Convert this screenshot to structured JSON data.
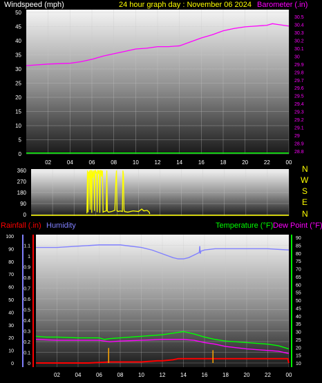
{
  "header": {
    "left_label": "Windspeed (mph)",
    "title": "24 hour graph day : November 06 2024",
    "right_label": "Barometer (.in)"
  },
  "colors": {
    "background": "#000000",
    "white_text": "#ffffff",
    "title_yellow": "#ffff00",
    "barometer": "#ff00ff",
    "windspeed": "#00ff00",
    "wind_dir": "#ffff00",
    "rain_axis": "#ff0000",
    "humidity": "#8080ff",
    "temperature": "#00ff00",
    "dew_point": "#ff00ff",
    "rain_total": "#ff0000",
    "rain_rate": "#ffa500"
  },
  "compass": [
    "N",
    "W",
    "S",
    "E",
    "N"
  ],
  "bottom_labels": {
    "rainfall": "Rainfall (.in)",
    "humidity": "Humidity",
    "temperature": "Temperature (°F)",
    "dew_point": "Dew Point (°F)"
  },
  "chart_data": [
    {
      "type": "line",
      "id": "wind_baro",
      "x_ticks": [
        "02",
        "04",
        "06",
        "08",
        "10",
        "12",
        "14",
        "16",
        "18",
        "20",
        "22",
        "00"
      ],
      "xlim": [
        0,
        24
      ],
      "left_axis": {
        "label": "Windspeed (mph)",
        "ticks": [
          0,
          5,
          10,
          15,
          20,
          25,
          30,
          35,
          40,
          45,
          50
        ],
        "ylim": [
          0,
          50
        ]
      },
      "right_axis": {
        "label": "Barometer (.in)",
        "ticks": [
          "28.8",
          "28.9",
          "29",
          "29.1",
          "29.2",
          "29.3",
          "29.4",
          "29.5",
          "29.6",
          "29.7",
          "29.8",
          "29.9",
          "30",
          "30.1",
          "30.2",
          "30.3",
          "30.4",
          "30.5"
        ],
        "ylim": [
          28.8,
          30.5
        ]
      },
      "series": [
        {
          "name": "Barometer (.in)",
          "axis": "right",
          "x": [
            0,
            2,
            4,
            5,
            6,
            7,
            8,
            9,
            10,
            11,
            12,
            13,
            14,
            15,
            16,
            17,
            18,
            19,
            20,
            21,
            22,
            22.5,
            23,
            24
          ],
          "y": [
            29.88,
            29.9,
            29.91,
            29.93,
            29.96,
            30.0,
            30.03,
            30.06,
            30.09,
            30.1,
            30.12,
            30.12,
            30.13,
            30.18,
            30.23,
            30.27,
            30.32,
            30.35,
            30.37,
            30.38,
            30.39,
            30.41,
            30.4,
            30.38
          ]
        },
        {
          "name": "Windspeed (mph)",
          "axis": "left",
          "x": [
            0,
            24
          ],
          "y": [
            0.3,
            0.3
          ]
        }
      ]
    },
    {
      "type": "line",
      "id": "wind_direction",
      "xlim": [
        0,
        24
      ],
      "y_ticks": [
        0,
        90,
        180,
        270,
        360
      ],
      "ylim": [
        0,
        360
      ],
      "series": [
        {
          "name": "Wind direction",
          "x": [
            0,
            5.2,
            5.25,
            5.3,
            5.35,
            5.4,
            5.45,
            5.5,
            5.55,
            5.6,
            5.65,
            5.7,
            5.75,
            5.8,
            5.85,
            5.9,
            5.95,
            6.0,
            6.05,
            6.1,
            6.15,
            6.2,
            6.25,
            6.3,
            6.35,
            6.4,
            6.45,
            6.5,
            6.55,
            6.6,
            6.65,
            6.7,
            6.8,
            7.0,
            7.05,
            7.1,
            7.2,
            7.5,
            7.8,
            7.9,
            7.95,
            8.0,
            8.05,
            8.1,
            8.3,
            8.5,
            8.55,
            8.6,
            8.65,
            8.7,
            9.0,
            9.5,
            10.0,
            10.3,
            10.5,
            10.8,
            11.0,
            11.05
          ],
          "y": [
            null,
            10,
            360,
            20,
            350,
            300,
            360,
            40,
            360,
            360,
            15,
            360,
            300,
            340,
            360,
            30,
            360,
            360,
            340,
            350,
            20,
            360,
            360,
            330,
            360,
            15,
            360,
            360,
            310,
            360,
            350,
            20,
            25,
            30,
            360,
            30,
            20,
            25,
            35,
            300,
            360,
            30,
            30,
            25,
            30,
            25,
            360,
            330,
            40,
            25,
            20,
            30,
            25,
            45,
            30,
            35,
            20,
            5
          ]
        }
      ]
    },
    {
      "type": "line",
      "id": "temp_hum_rain",
      "x_ticks": [
        "02",
        "04",
        "06",
        "08",
        "10",
        "12",
        "14",
        "16",
        "18",
        "20",
        "22",
        "00"
      ],
      "xlim": [
        0,
        24
      ],
      "rain_axis": {
        "label": "Rainfall (.in)",
        "ticks": [
          "0",
          "0.1",
          "0.2",
          "0.3",
          "0.4",
          "0.5",
          "0.6",
          "0.7",
          "0.8",
          "0.9",
          "1",
          "1.1"
        ],
        "ylim": [
          0,
          1.2
        ]
      },
      "humidity_axis": {
        "label": "Humidity",
        "ticks": [
          0,
          10,
          20,
          30,
          40,
          50,
          60,
          70,
          80,
          90,
          100
        ],
        "ylim": [
          0,
          100
        ]
      },
      "temp_axis": {
        "label": "Temperature (°F)",
        "ticks": [
          10,
          15,
          20,
          25,
          30,
          35,
          40,
          45,
          50,
          55,
          60,
          65,
          70,
          75,
          80,
          85,
          90
        ],
        "ylim": [
          8,
          92
        ]
      },
      "series": [
        {
          "name": "Humidity",
          "axis": "humidity",
          "x": [
            0,
            2,
            4,
            6,
            8,
            10,
            11,
            12,
            13,
            13.5,
            14,
            14.5,
            15,
            15.5,
            15.55,
            15.6,
            15.65,
            16,
            17,
            18,
            20,
            22,
            24
          ],
          "y": [
            91,
            91,
            92,
            93,
            93,
            91,
            89,
            86,
            83,
            82,
            82,
            83,
            85,
            87,
            92,
            86,
            88,
            89,
            90,
            90,
            90,
            90,
            89
          ]
        },
        {
          "name": "Temperature (°F)",
          "axis": "temp",
          "x": [
            0,
            1,
            2,
            4,
            6,
            6.5,
            7,
            8,
            9,
            10,
            11,
            12,
            13,
            14,
            15,
            16,
            17,
            18,
            19,
            20,
            22,
            23,
            24
          ],
          "y": [
            27,
            26.5,
            26.5,
            26,
            26,
            25,
            25.5,
            26,
            26.5,
            27,
            27.5,
            28,
            29,
            30,
            28.5,
            26.5,
            25,
            24,
            23.5,
            23,
            22,
            21,
            19
          ]
        },
        {
          "name": "Dew Point (°F)",
          "axis": "temp",
          "x": [
            0,
            2,
            4,
            6,
            7,
            8,
            10,
            12,
            13,
            14,
            15,
            16,
            17,
            18,
            20,
            22,
            23,
            24
          ],
          "y": [
            25,
            24.5,
            24.5,
            24.5,
            23.5,
            24,
            24.5,
            25,
            25,
            25,
            24.5,
            23,
            22,
            20.5,
            19,
            18,
            17.5,
            16
          ]
        },
        {
          "name": "Rain total",
          "axis": "rain",
          "x": [
            0,
            5,
            7,
            8,
            10,
            11.5,
            12,
            13,
            13.5,
            14,
            16,
            18,
            20,
            22,
            23.9,
            24
          ],
          "y": [
            0.0,
            0.0,
            0.01,
            0.01,
            0.01,
            0.02,
            0.02,
            0.03,
            0.04,
            0.04,
            0.04,
            0.04,
            0.04,
            0.04,
            0.04,
            0.0
          ]
        },
        {
          "name": "Rain rate",
          "axis": "rain",
          "type": "bar",
          "x": [
            6.9,
            16.8
          ],
          "y": [
            0.14,
            0.12
          ]
        }
      ]
    }
  ]
}
